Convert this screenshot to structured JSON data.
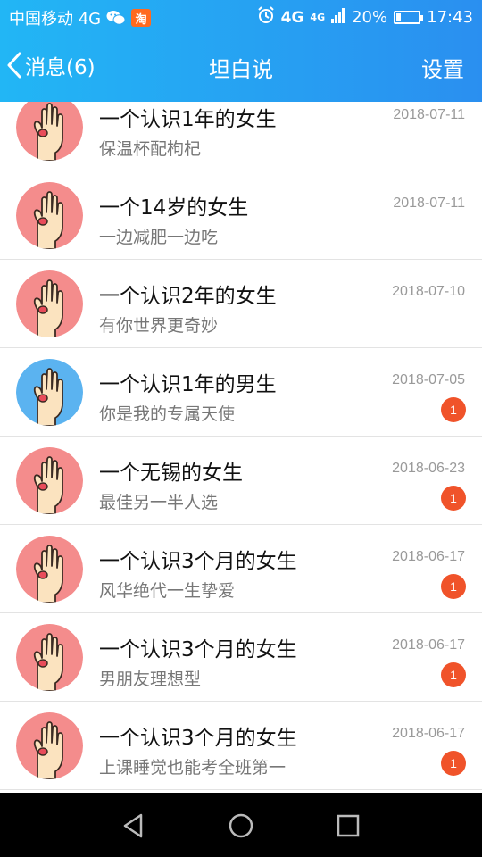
{
  "status_bar": {
    "carrier": "中国移动 4G",
    "taobao_label": "淘",
    "net_top": "4G",
    "net_second": "4G",
    "battery_text": "20%",
    "battery_level": 0.2,
    "time": "17:43"
  },
  "nav": {
    "back_label": "消息(6)",
    "title": "坦白说",
    "settings_label": "设置"
  },
  "colors": {
    "bar_start": "#22b6f5",
    "bar_end": "#2a8ff0",
    "avatar_female": "#f48c8c",
    "avatar_male": "#5bb3f0",
    "badge": "#f0532a"
  },
  "messages": [
    {
      "title": "一个认识1年的女生",
      "subtitle": "保温杯配枸杞",
      "date": "2018-07-11",
      "gender": "female",
      "badge": ""
    },
    {
      "title": "一个14岁的女生",
      "subtitle": "一边减肥一边吃",
      "date": "2018-07-11",
      "gender": "female",
      "badge": ""
    },
    {
      "title": "一个认识2年的女生",
      "subtitle": "有你世界更奇妙",
      "date": "2018-07-10",
      "gender": "female",
      "badge": ""
    },
    {
      "title": "一个认识1年的男生",
      "subtitle": "你是我的专属天使",
      "date": "2018-07-05",
      "gender": "male",
      "badge": "1"
    },
    {
      "title": "一个无锡的女生",
      "subtitle": "最佳另一半人选",
      "date": "2018-06-23",
      "gender": "female",
      "badge": "1"
    },
    {
      "title": "一个认识3个月的女生",
      "subtitle": "风华绝代一生挚爱",
      "date": "2018-06-17",
      "gender": "female",
      "badge": "1"
    },
    {
      "title": "一个认识3个月的女生",
      "subtitle": "男朋友理想型",
      "date": "2018-06-17",
      "gender": "female",
      "badge": "1"
    },
    {
      "title": "一个认识3个月的女生",
      "subtitle": "上课睡觉也能考全班第一",
      "date": "2018-06-17",
      "gender": "female",
      "badge": "1"
    }
  ],
  "system_nav": [
    "back-triangle-icon",
    "home-circle-icon",
    "recents-square-icon"
  ]
}
